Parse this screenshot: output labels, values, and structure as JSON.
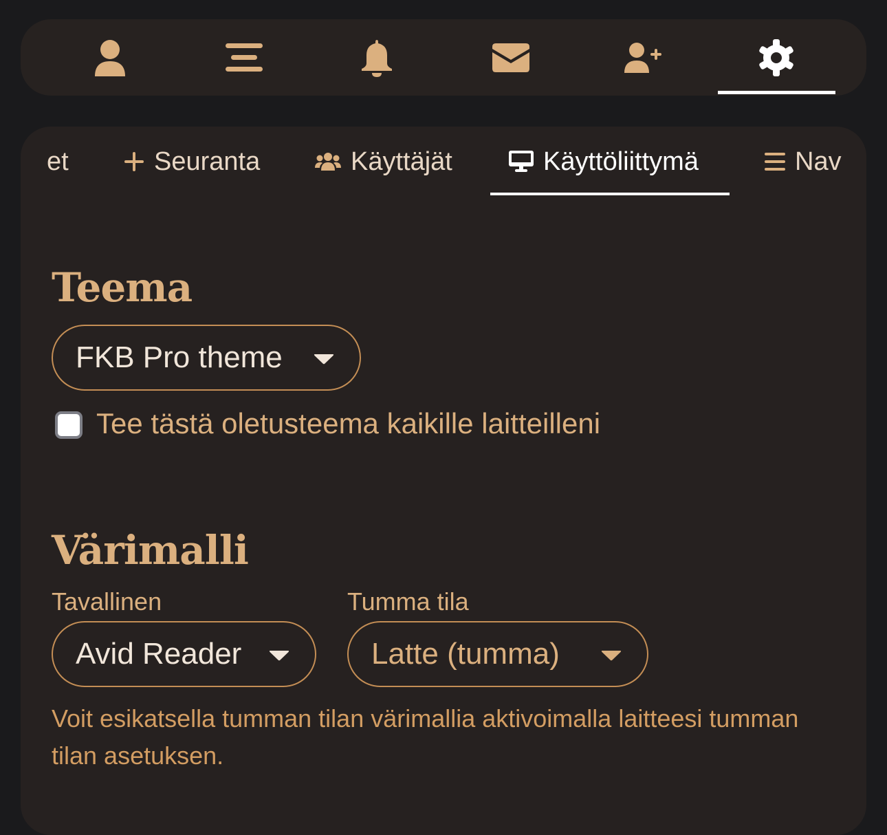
{
  "topbar": {
    "icons": [
      "user-icon",
      "menu-lines-icon",
      "bell-icon",
      "envelope-icon",
      "user-plus-icon",
      "gear-icon"
    ],
    "active": "gear-icon"
  },
  "tabs": [
    {
      "label": "et",
      "icon": null
    },
    {
      "label": "Seuranta",
      "icon": "plus-icon"
    },
    {
      "label": "Käyttäjät",
      "icon": "users-icon"
    },
    {
      "label": "Käyttöliittymä",
      "icon": "desktop-icon",
      "active": true
    },
    {
      "label": "Nav",
      "icon": "bars-icon"
    }
  ],
  "theme": {
    "heading": "Teema",
    "select_value": "FKB Pro theme",
    "default_checkbox_label": "Tee tästä oletusteema kaikille laitteilleni",
    "default_checked": false
  },
  "colormodel": {
    "heading": "Värimalli",
    "normal_label": "Tavallinen",
    "normal_value": "Avid Reader",
    "dark_label": "Tumma tila",
    "dark_value": "Latte (tumma)",
    "hint": "Voit esikatsella tumman tilan värimallia aktivoimalla laitteesi tumman tilan asetuksen."
  },
  "colors": {
    "accent": "#dbb07f",
    "border": "#c48e55",
    "panel": "#262120",
    "background": "#1a1a1c"
  }
}
